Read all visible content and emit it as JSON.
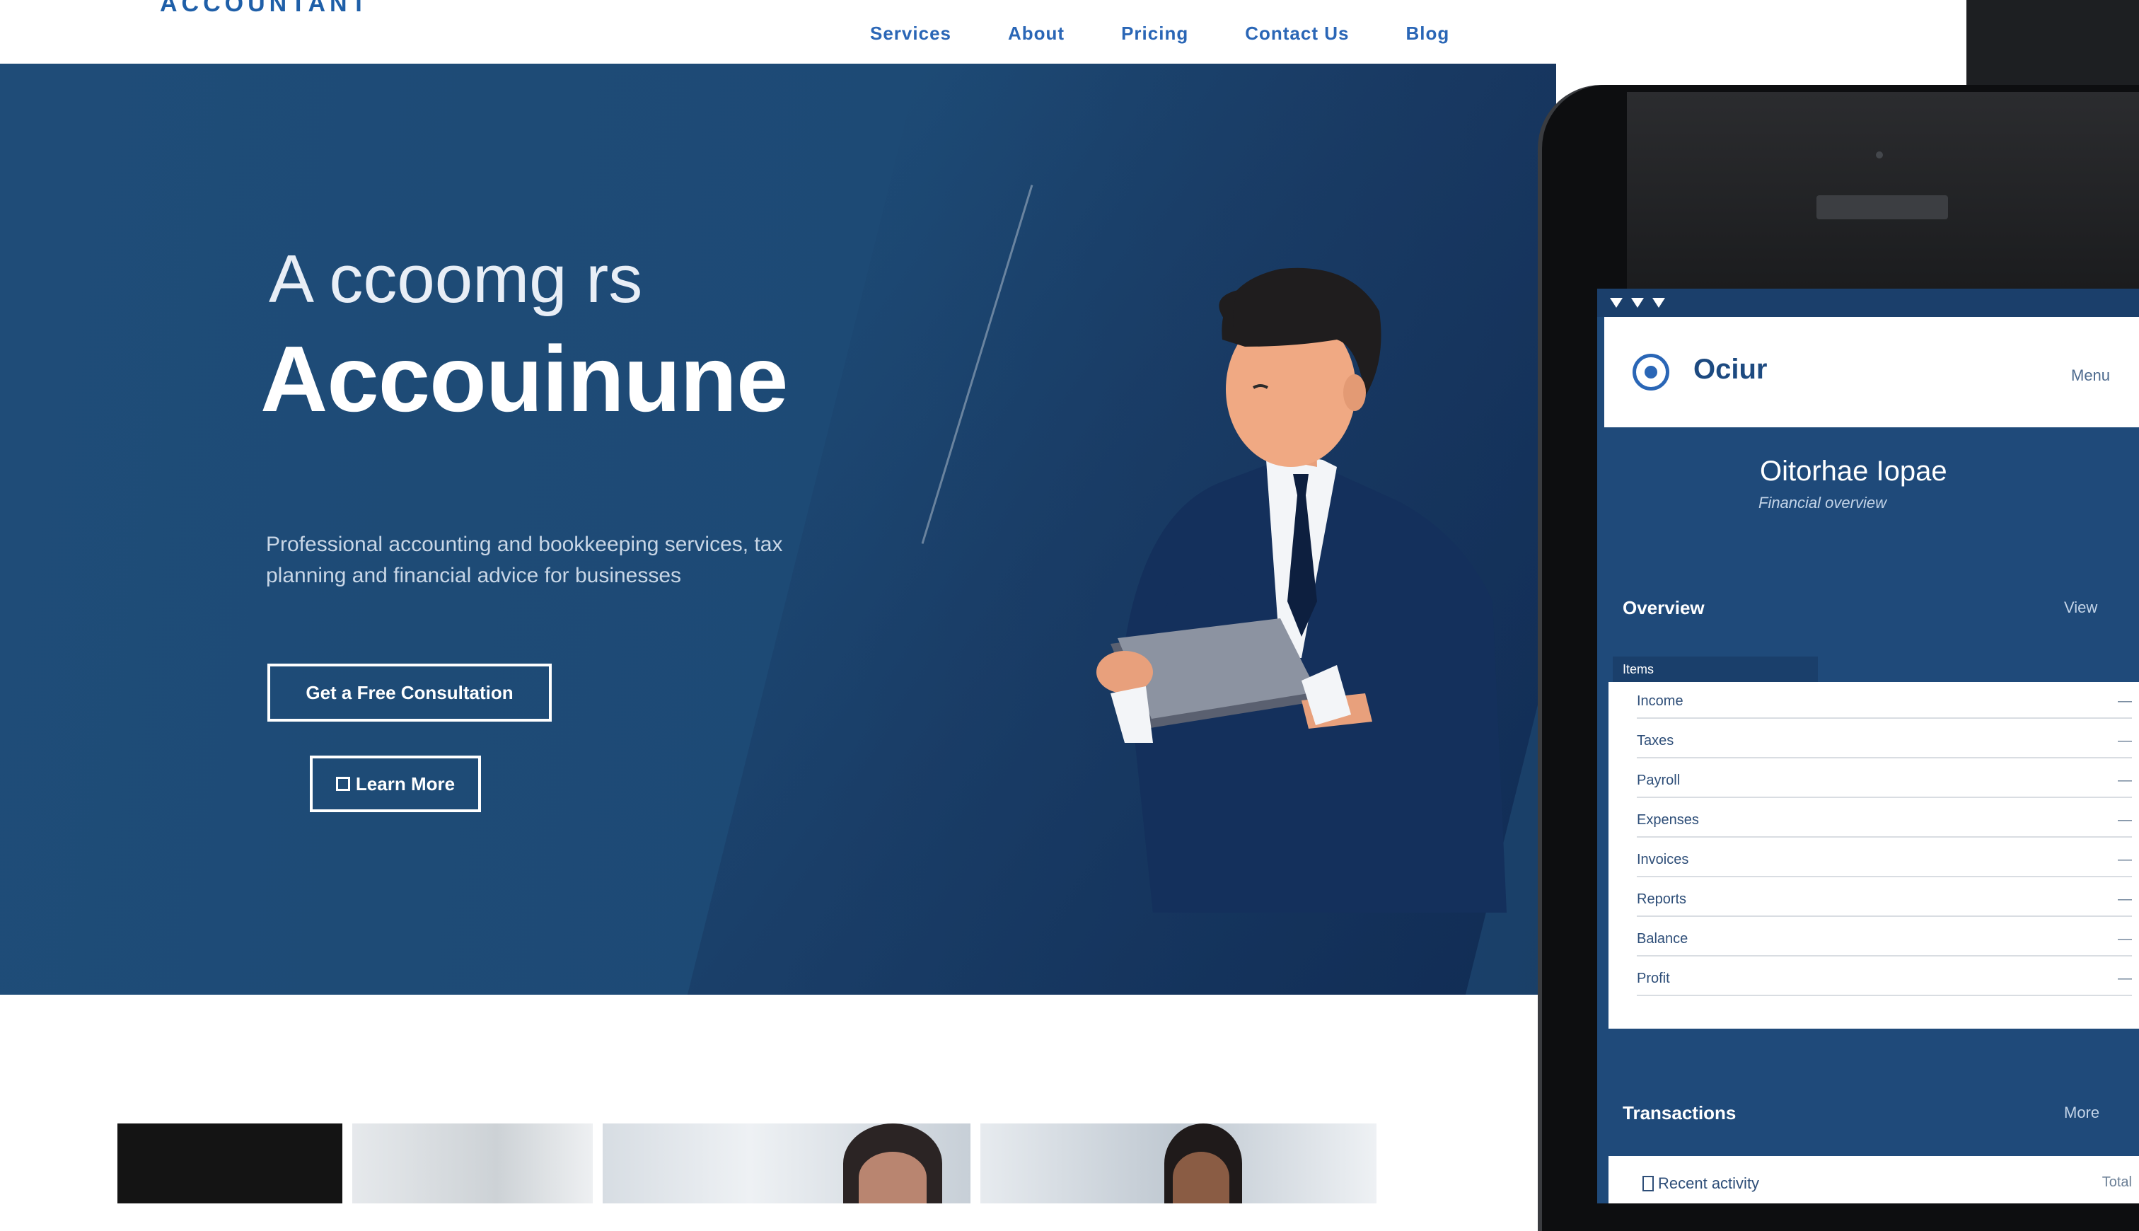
{
  "header": {
    "brand": "ACCOUNTANT",
    "nav": [
      "Services",
      "About",
      "Pricing",
      "Contact Us",
      "Blog"
    ]
  },
  "hero": {
    "tagline": "A ccoomg rs",
    "title": "Accouinune",
    "description": "Professional accounting and bookkeeping services, tax planning and financial advice for businesses",
    "primary_cta": "Get a Free Consultation",
    "secondary_cta": "Learn More"
  },
  "mobile": {
    "app_name": "Ociur",
    "header_meta": "Menu",
    "title": "Oitorhae Iopae",
    "subtitle": "Financial overview",
    "section_1": "Overview",
    "section_1_link": "View",
    "tab_label": "Items",
    "rows": [
      {
        "label": "Income",
        "value": "—"
      },
      {
        "label": "Taxes",
        "value": "—"
      },
      {
        "label": "Payroll",
        "value": "—"
      },
      {
        "label": "Expenses",
        "value": "—"
      },
      {
        "label": "Invoices",
        "value": "—"
      },
      {
        "label": "Reports",
        "value": "—"
      },
      {
        "label": "Balance",
        "value": "—"
      },
      {
        "label": "Profit",
        "value": "—"
      }
    ],
    "section_2": "Transactions",
    "section_2_link": "More",
    "bottom_item": "Recent activity",
    "bottom_value": "Total"
  },
  "colors": {
    "hero_bg": "#1f4c78",
    "accent": "#2a66b6",
    "phone_body": "#0d0e10"
  }
}
